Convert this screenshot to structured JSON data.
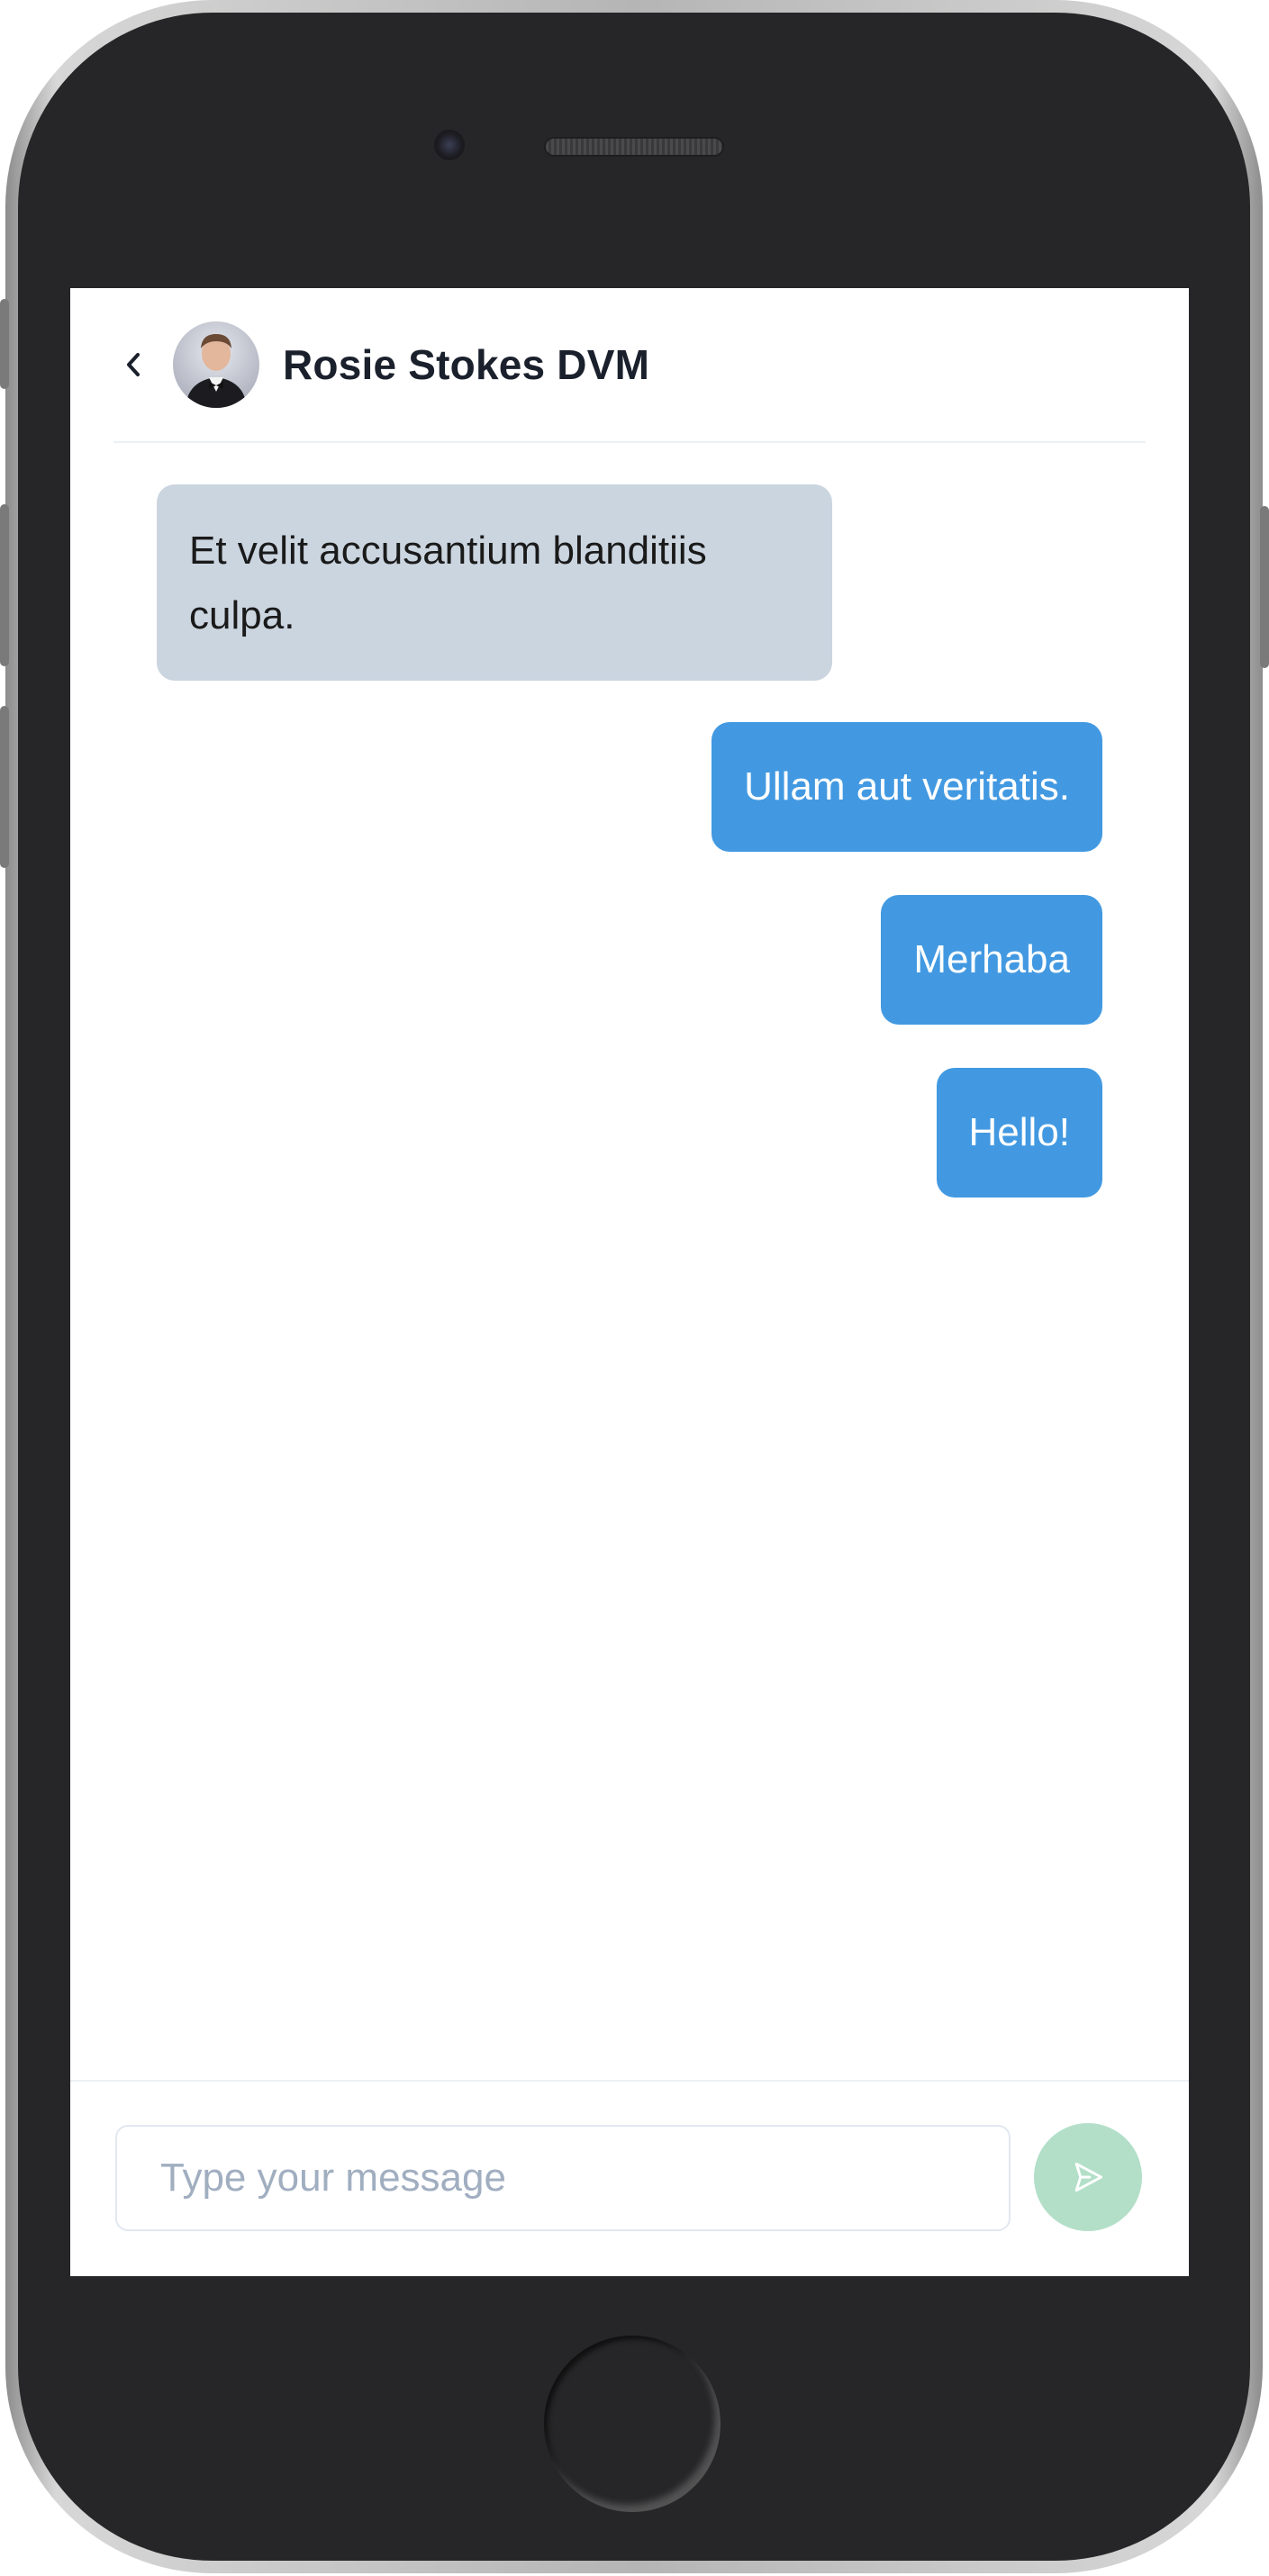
{
  "header": {
    "back_icon": "chevron-left-icon",
    "avatar_icon": "contact-avatar",
    "contact_name": "Rosie Stokes DVM"
  },
  "messages": [
    {
      "direction": "incoming",
      "text": "Et velit accusantium blanditiis culpa."
    },
    {
      "direction": "outgoing",
      "text": "Ullam aut veritatis."
    },
    {
      "direction": "outgoing",
      "text": "Merhaba"
    },
    {
      "direction": "outgoing",
      "text": "Hello!"
    }
  ],
  "composer": {
    "placeholder": "Type your message",
    "value": "",
    "send_icon": "send-icon"
  },
  "colors": {
    "incoming_bubble": "#cbd5e0",
    "outgoing_bubble": "#4299e1",
    "send_button": "#b3dfc8",
    "title_text": "#1a202c"
  }
}
